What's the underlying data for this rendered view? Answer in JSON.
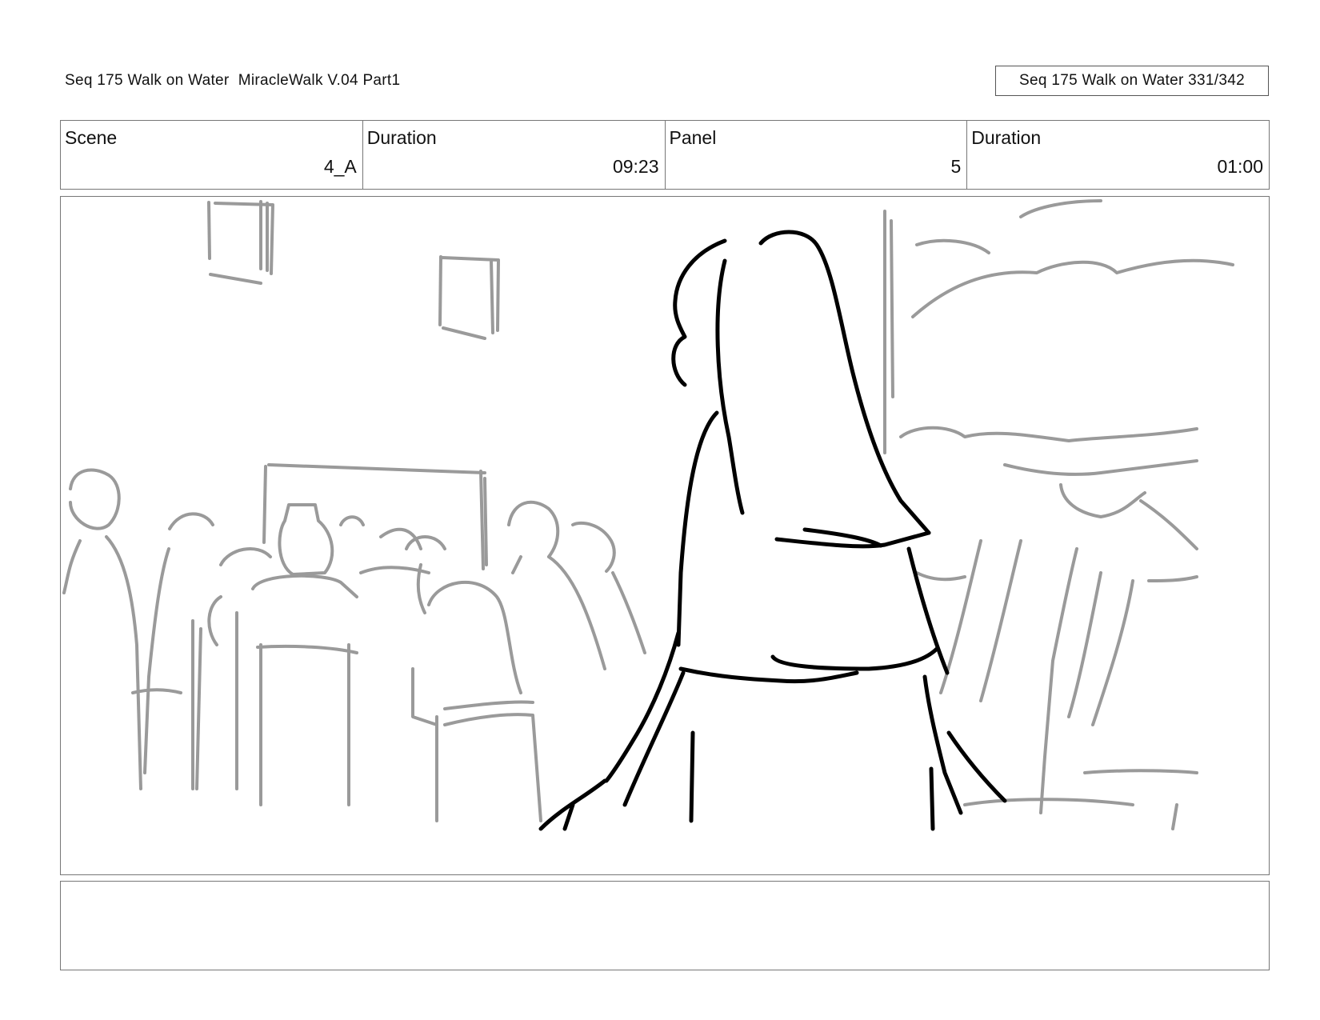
{
  "header": {
    "title": "Seq 175 Walk on Water  MiracleWalk V.04 Part1",
    "page_counter": "Seq 175 Walk on Water 331/342"
  },
  "info": {
    "scene_label": "Scene",
    "scene_value": "4_A",
    "duration_label": "Duration",
    "duration_value": "09:23",
    "panel_label": "Panel",
    "panel_value": "5",
    "panel_duration_label": "Duration",
    "panel_duration_value": "01:00"
  },
  "panel": {
    "image": "storyboard-sketch"
  },
  "notes": {
    "text": ""
  }
}
